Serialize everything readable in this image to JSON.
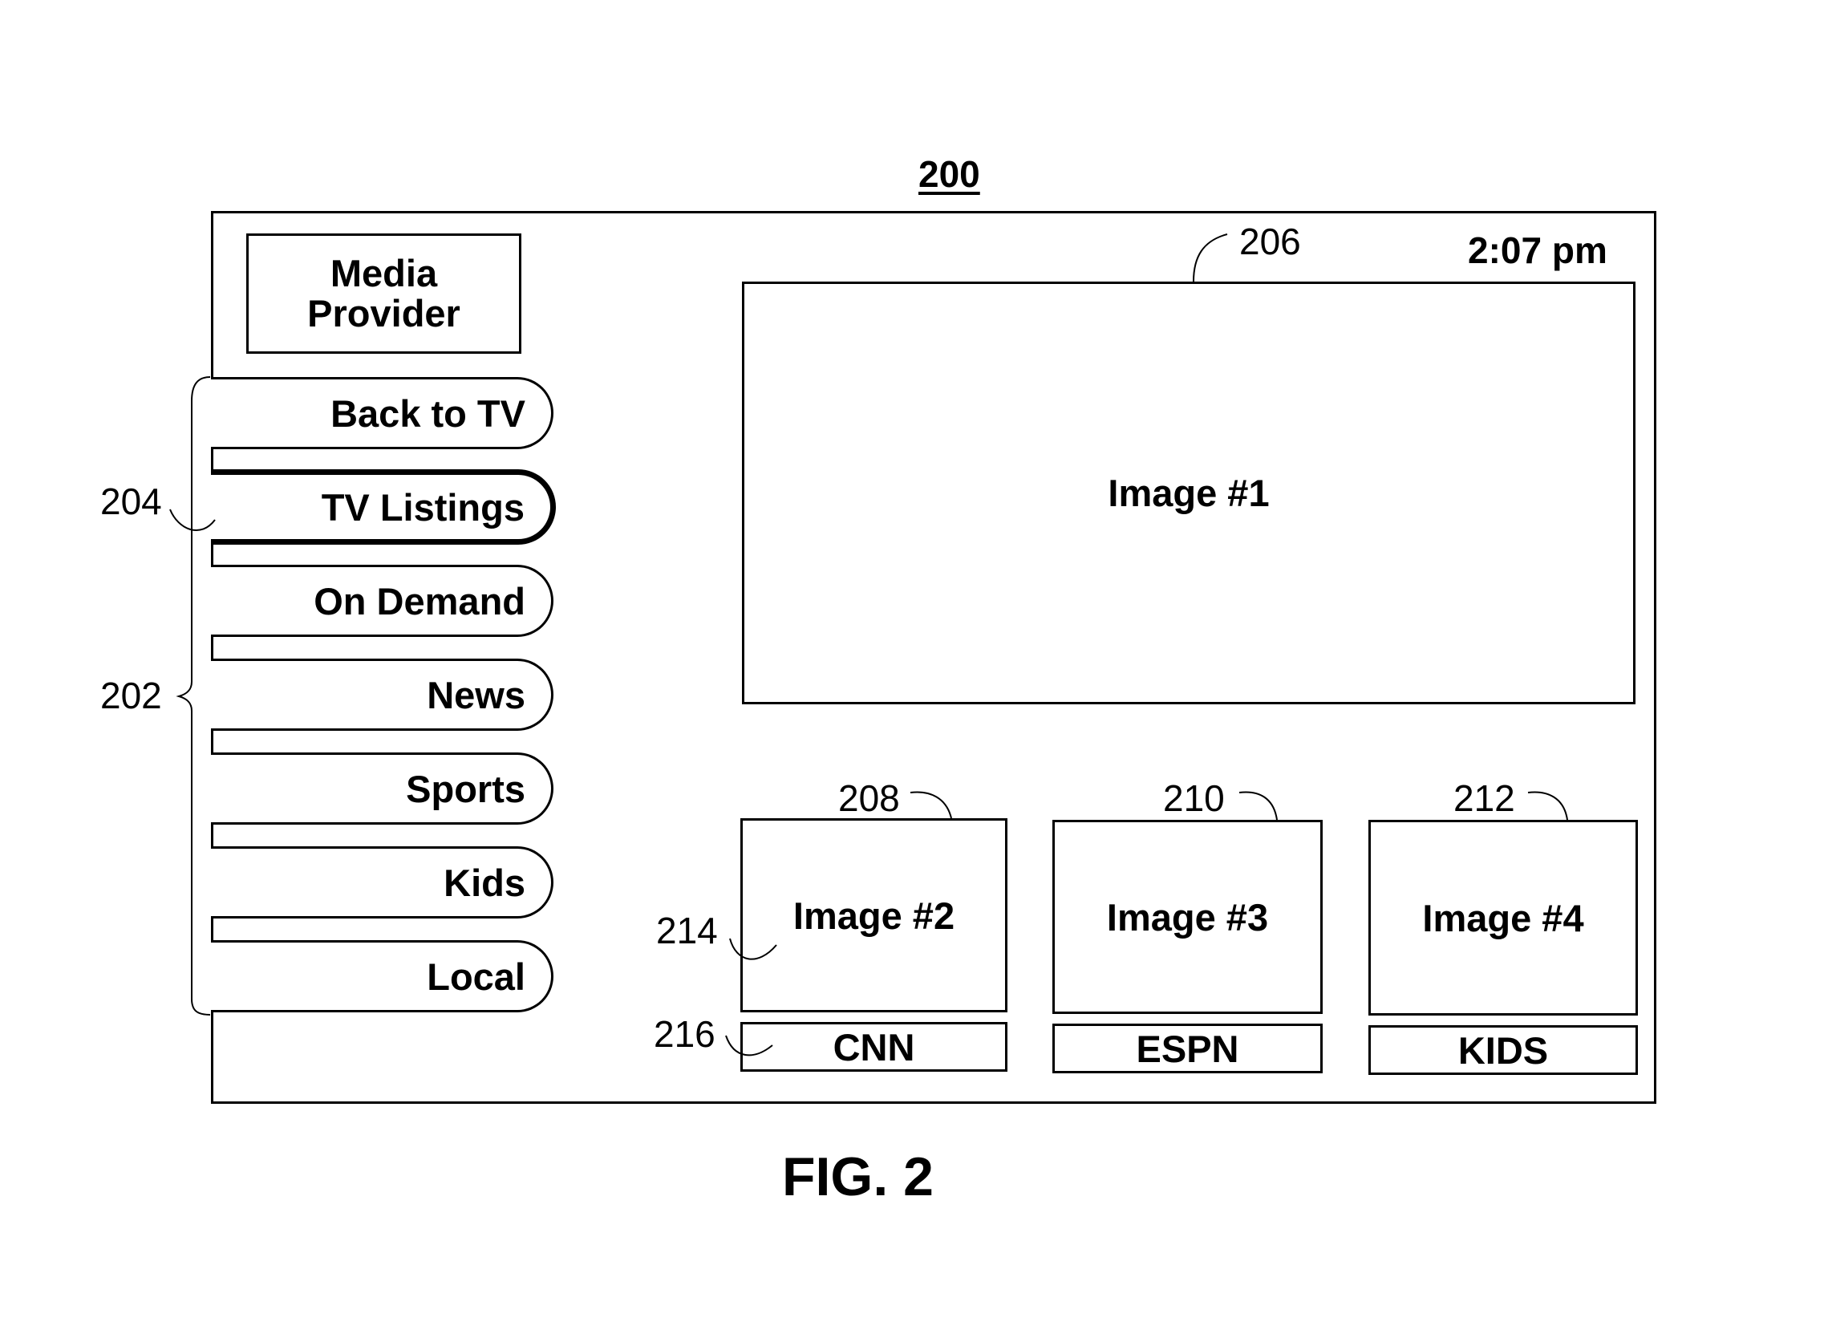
{
  "figure": {
    "number": "200",
    "caption": "FIG. 2"
  },
  "header": {
    "provider_label": "Media\nProvider",
    "time": "2:07 pm"
  },
  "menu": {
    "items": [
      {
        "label": "Back to TV",
        "selected": false
      },
      {
        "label": "TV Listings",
        "selected": true
      },
      {
        "label": "On Demand",
        "selected": false
      },
      {
        "label": "News",
        "selected": false
      },
      {
        "label": "Sports",
        "selected": false
      },
      {
        "label": "Kids",
        "selected": false
      },
      {
        "label": "Local",
        "selected": false
      }
    ]
  },
  "main_image": {
    "label": "Image #1"
  },
  "thumbnails": [
    {
      "image_label": "Image #2",
      "channel": "CNN"
    },
    {
      "image_label": "Image #3",
      "channel": "ESPN"
    },
    {
      "image_label": "Image #4",
      "channel": "KIDS"
    }
  ],
  "reference_numerals": {
    "menu_group": "202",
    "selected_item": "204",
    "main_image": "206",
    "thumb1": "208",
    "thumb2": "210",
    "thumb3": "212",
    "thumb_image": "214",
    "channel_label": "216"
  }
}
